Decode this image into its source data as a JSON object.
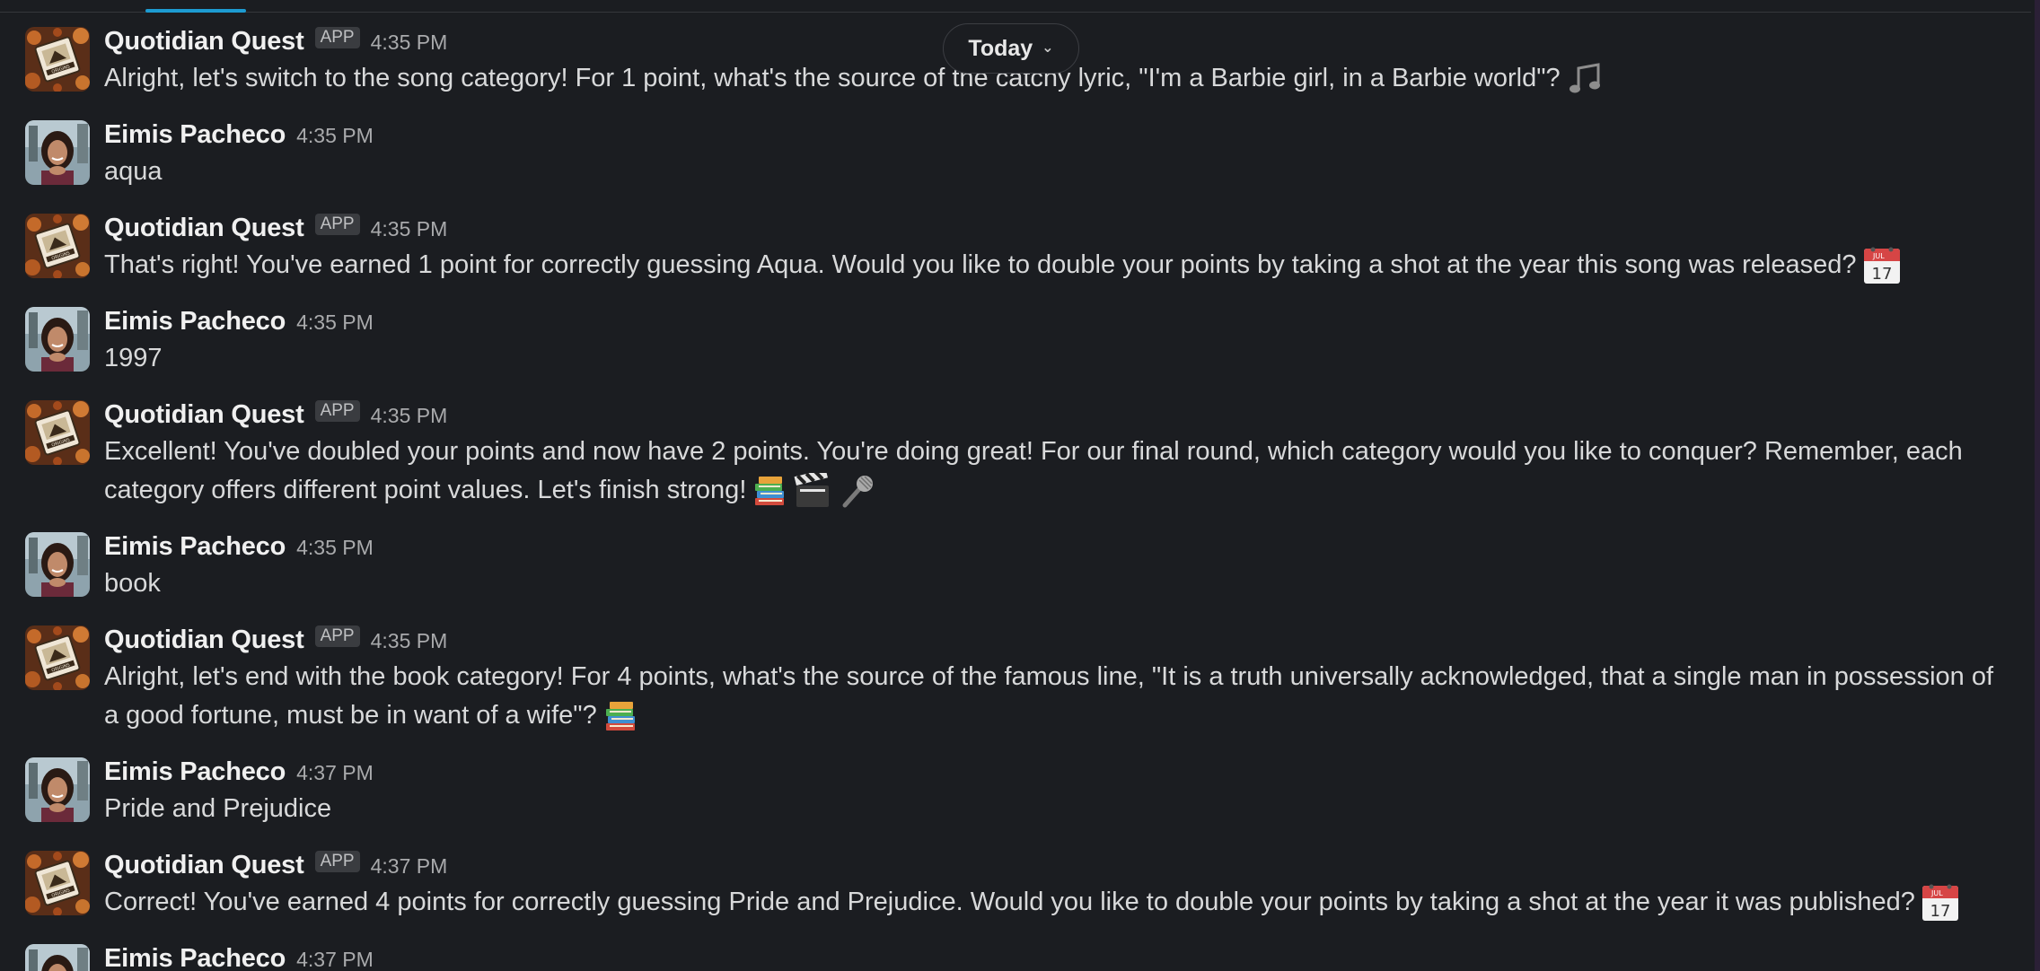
{
  "date_divider": {
    "label": "Today"
  },
  "messages": [
    {
      "sender": "Quotidian Quest",
      "badge": "APP",
      "time": "4:35 PM",
      "text": "Alright, let's switch to the song category! For 1 point, what's the source of the catchy lyric, \"I'm a Barbie girl, in a Barbie world\"?",
      "avatar": "quotidian-quest-avatar",
      "emojis": [
        "musical-notes"
      ]
    },
    {
      "sender": "Eimis Pacheco",
      "time": "4:35 PM",
      "text": "aqua",
      "avatar": "eimis-avatar"
    },
    {
      "sender": "Quotidian Quest",
      "badge": "APP",
      "time": "4:35 PM",
      "text": "That's right! You've earned 1 point for correctly guessing Aqua. Would you like to double your points by taking a shot at the year this song was released?",
      "avatar": "quotidian-quest-avatar",
      "emojis": [
        "calendar"
      ]
    },
    {
      "sender": "Eimis Pacheco",
      "time": "4:35 PM",
      "text": "1997",
      "avatar": "eimis-avatar"
    },
    {
      "sender": "Quotidian Quest",
      "badge": "APP",
      "time": "4:35 PM",
      "text": "Excellent! You've doubled your points and now have 2 points. You're doing great! For our final round, which category would you like to conquer? Remember, each category offers different point values. Let's finish strong!",
      "avatar": "quotidian-quest-avatar",
      "emojis": [
        "books",
        "clapper-board",
        "microphone"
      ]
    },
    {
      "sender": "Eimis Pacheco",
      "time": "4:35 PM",
      "text": "book",
      "avatar": "eimis-avatar"
    },
    {
      "sender": "Quotidian Quest",
      "badge": "APP",
      "time": "4:35 PM",
      "text": "Alright, let's end with the book category! For 4 points, what's the source of the famous line, \"It is a truth universally acknowledged, that a single man in possession of a good fortune, must be in want of a wife\"?",
      "avatar": "quotidian-quest-avatar",
      "emojis": [
        "books"
      ]
    },
    {
      "sender": "Eimis Pacheco",
      "time": "4:37 PM",
      "text": "Pride and Prejudice",
      "avatar": "eimis-avatar"
    },
    {
      "sender": "Quotidian Quest",
      "badge": "APP",
      "time": "4:37 PM",
      "text": "Correct! You've earned 4 points for correctly guessing Pride and Prejudice. Would you like to double your points by taking a shot at the year it was published?",
      "avatar": "quotidian-quest-avatar",
      "emojis": [
        "calendar"
      ]
    },
    {
      "sender": "Eimis Pacheco",
      "time": "4:37 PM",
      "text": "",
      "avatar": "eimis-avatar"
    }
  ],
  "emoji_text": {
    "calendar_month": "JUL",
    "calendar_day": "17"
  },
  "colors": {
    "background": "#1b1d21",
    "accent": "#1d9bd1",
    "name": "#f0f0f0",
    "text": "#d8d9da"
  }
}
